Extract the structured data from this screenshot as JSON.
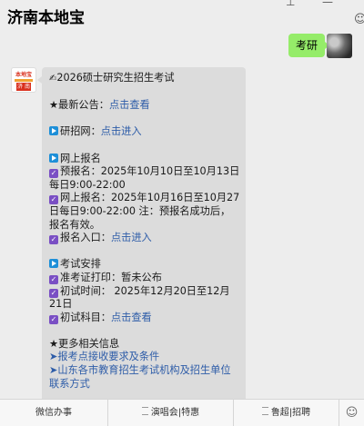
{
  "window": {
    "title": "济南本地宝",
    "icons": [
      "pin-icon",
      "minimize-icon",
      "user-icon"
    ]
  },
  "chat": {
    "sent_message": "考研",
    "oa_avatar": {
      "top": "本地宝",
      "bottom": "济 南"
    },
    "received": {
      "title": "2026硕士研究生招生考试",
      "title_emoji": "✍",
      "notice_label": "★最新公告：",
      "notice_link": "点击查看",
      "yzw_label": "研招网：",
      "yzw_link": "点击进入",
      "online_reg_header": "网上报名",
      "prereg": "预报名：2025年10月10日至10月13日每日9:00-22:00",
      "online_reg": "网上报名：2025年10月16日至10月27日每日9:00-22:00 注：预报名成功后，报名有效。",
      "reg_entry_label": "报名入口：",
      "reg_entry_link": "点击进入",
      "exam_header": "考试安排",
      "admit_print": "准考证打印：暂未公布",
      "first_exam_time": "初试时间： 2025年12月20日至12月21日",
      "first_subjects_label": "初试科目：",
      "first_subjects_link": "点击查看",
      "more_header": "★更多相关信息",
      "more_links": [
        "➤报考点接收要求及条件",
        "➤山东各市教育招生考试机构及招生单位联系方式"
      ]
    }
  },
  "menu": {
    "items": [
      "微信办事",
      "演唱会|特惠",
      "鲁超|招聘"
    ],
    "emoji_icon": "☺"
  },
  "colors": {
    "background": "#ededed",
    "sent_bubble": "#95ec69",
    "received_bubble": "#dcdcdc",
    "link": "#2d5ca8",
    "check_icon": "#7a4fc4",
    "play_icon": "#1e8fd8"
  }
}
